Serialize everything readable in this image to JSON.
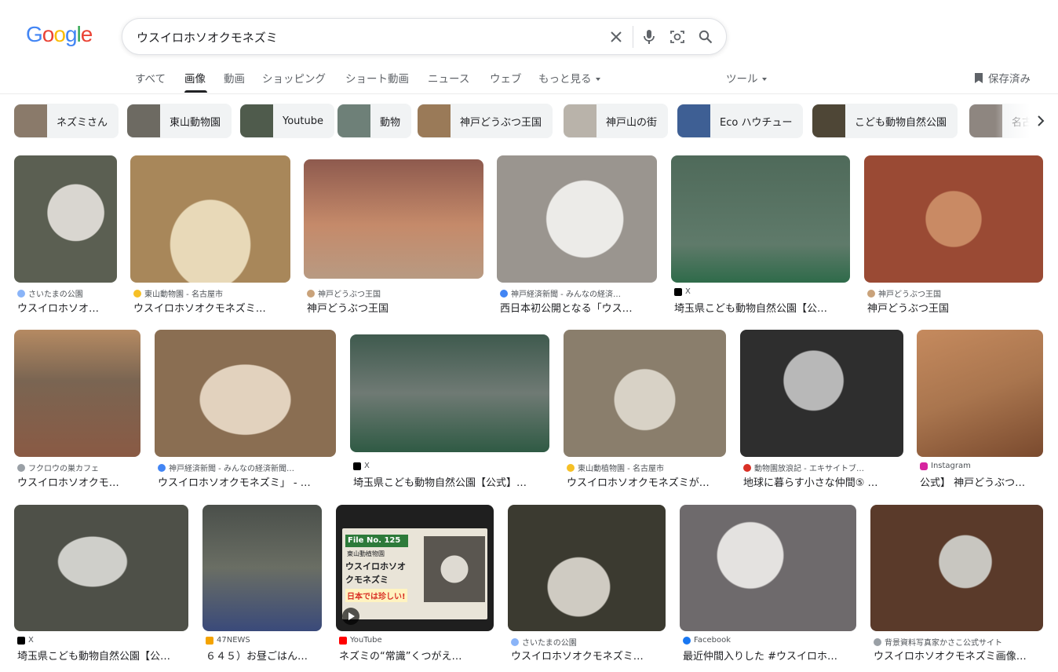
{
  "logo": {
    "letters": [
      "G",
      "o",
      "o",
      "g",
      "l",
      "e"
    ],
    "colors": [
      "#4285f4",
      "#ea4335",
      "#fbbc05",
      "#4285f4",
      "#34a853",
      "#ea4335"
    ]
  },
  "search": {
    "query": "ウスイロホソオクモネズミ"
  },
  "tabs": [
    {
      "label": "すべて",
      "active": false
    },
    {
      "label": "画像",
      "active": true
    },
    {
      "label": "動画",
      "active": false
    },
    {
      "label": "ショッピング",
      "active": false
    },
    {
      "label": "ショート動画",
      "active": false
    },
    {
      "label": "ニュース",
      "active": false
    },
    {
      "label": "ウェブ",
      "active": false
    },
    {
      "label": "もっと見る",
      "active": false,
      "dropdown": true
    }
  ],
  "tools": {
    "label": "ツール"
  },
  "saved": {
    "label": "保存済み"
  },
  "chips": [
    {
      "label": "ネズミさん",
      "color": "#8a7a6a"
    },
    {
      "label": "東山動物園",
      "color": "#6d6a62"
    },
    {
      "label": "Youtube",
      "color": "#4f5b4c"
    },
    {
      "label": "動物",
      "color": "#6e8078"
    },
    {
      "label": "神戸どうぶつ王国",
      "color": "#9a7a58"
    },
    {
      "label": "神戸山の街",
      "color": "#b9b3aa"
    },
    {
      "label": "Eco ハウチュー",
      "color": "#3e5f94"
    },
    {
      "label": "こども動物自然公園",
      "color": "#4e4636"
    },
    {
      "label": "名古",
      "color": "#8e8680"
    }
  ],
  "rows": [
    [
      {
        "source": "さいたまの公園",
        "title": "ウスイロホソオ…",
        "color": "#5b5f52",
        "fav": "#8ab4f8"
      },
      {
        "source": "東山動物園 - 名古屋市",
        "title": "ウスイロホソオクモネズミ…",
        "color": "#a8875a",
        "fav": "#f6c026"
      },
      {
        "source": "神戸どうぶつ王国",
        "title": "神戸どうぶつ王国",
        "color": "#8e5a4e",
        "fav": "#c9a27a"
      },
      {
        "source": "神戸経済新聞 - みんなの経済…",
        "title": "西日本初公開となる「ウス…",
        "color": "#9a958f",
        "fav": "#4285f4"
      },
      {
        "source": "X",
        "title": "埼玉県こども動物自然公園【公…",
        "color": "#4f6a5a",
        "fav": "#000000"
      },
      {
        "source": "神戸どうぶつ王国",
        "title": "神戸どうぶつ王国",
        "color": "#9a4a34",
        "fav": "#c9a27a"
      }
    ],
    [
      {
        "source": "フクロウの巣カフェ",
        "title": "ウスイロホソオクモ…",
        "color": "#7a6552",
        "fav": "#9aa0a6"
      },
      {
        "source": "神戸経済新聞 - みんなの経済新聞…",
        "title": "ウスイロホソオクモネズミ」 - …",
        "color": "#8a6e52",
        "fav": "#4285f4"
      },
      {
        "source": "X",
        "title": "埼玉県こども動物自然公園【公式】…",
        "color": "#3f5a4e",
        "fav": "#000000"
      },
      {
        "source": "東山動植物園 - 名古屋市",
        "title": "ウスイロホソオクモネズミが…",
        "color": "#8a7e6c",
        "fav": "#f6c026"
      },
      {
        "source": "動物園放浪記 - エキサイトブ…",
        "title": "地球に暮らす小さな仲間⑤ …",
        "color": "#2e2e2e",
        "fav": "#d93025"
      },
      {
        "source": "Instagram",
        "title": "公式】 神戸どうぶつ…",
        "color": "#a9754e",
        "fav": "#d6249f"
      }
    ],
    [
      {
        "source": "X",
        "title": "埼玉県こども動物自然公園【公…",
        "color": "#4e5048",
        "fav": "#000000"
      },
      {
        "source": "47NEWS",
        "title": "６４５）お昼ごはん…",
        "color": "#4a4f4a",
        "fav": "#f4a300"
      },
      {
        "source": "YouTube",
        "title": "ネズミの“常識”くつがえ…",
        "color": "#1f1f1f",
        "fav": "#ff0000",
        "video": true
      },
      {
        "source": "さいたまの公園",
        "title": "ウスイロホソオクモネズミ…",
        "color": "#3b3a30",
        "fav": "#8ab4f8"
      },
      {
        "source": "Facebook",
        "title": "最近仲間入りした #ウスイロホ…",
        "color": "#6e6a6c",
        "fav": "#1877f2"
      },
      {
        "source": "背景資料写真家かさこ公式サイト",
        "title": "ウスイロホソオクモネズミ画像…",
        "color": "#5a3a2a",
        "fav": "#9aa0a6"
      }
    ]
  ],
  "overlay": {
    "file_no": "File No. 125",
    "zoo": "東山動植物園",
    "name_line1": "ウスイロホソオ",
    "name_line2": "クモネズミ",
    "tagline": "日本では珍しい!"
  }
}
